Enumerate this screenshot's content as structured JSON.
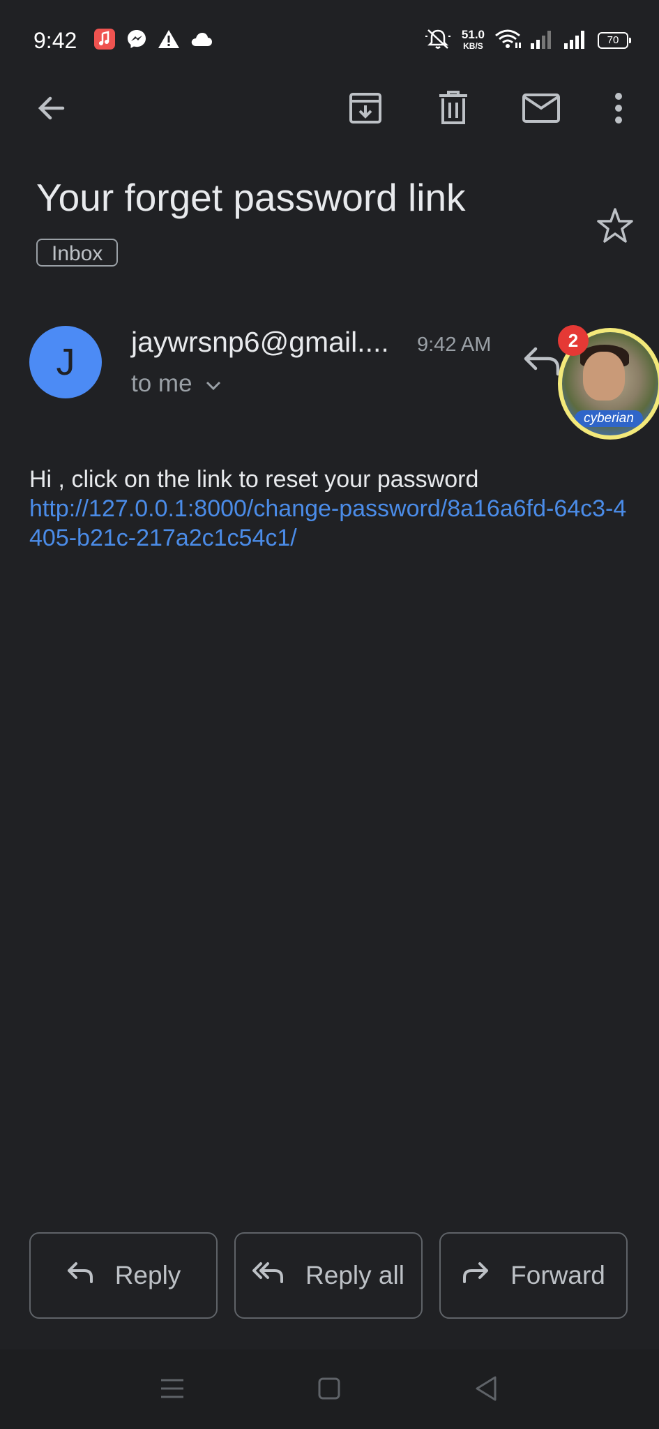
{
  "status_bar": {
    "time": "9:42",
    "net_speed_value": "51.0",
    "net_speed_unit": "KB/S",
    "battery": "70",
    "left_icons": [
      "music-app-icon",
      "messenger-icon",
      "warning-icon",
      "cloud-icon"
    ],
    "right_icons": [
      "mute-icon",
      "wifi-icon",
      "signal-icon",
      "signal-icon"
    ]
  },
  "toolbar": {
    "icons": [
      "back-arrow-icon",
      "archive-icon",
      "delete-icon",
      "mark-unread-icon",
      "more-vert-icon"
    ]
  },
  "email": {
    "subject": "Your forget password link",
    "label": "Inbox",
    "sender_initial": "J",
    "sender": "jaywrsnp6@gmail....",
    "time": "9:42 AM",
    "recipient": "to me",
    "body_text": "Hi , click on the link to reset your password",
    "link": "http://127.0.0.1:8000/change-password/8a16a6fd-64c3-4405-b21c-217a2c1c54c1/"
  },
  "chat_head": {
    "badge": "2",
    "caption": "cyberian"
  },
  "actions": {
    "reply": "Reply",
    "reply_all": "Reply all",
    "forward": "Forward"
  },
  "colors": {
    "background": "#202124",
    "link": "#4b8ce8",
    "avatar": "#4c8bf5",
    "badge": "#e53935"
  }
}
